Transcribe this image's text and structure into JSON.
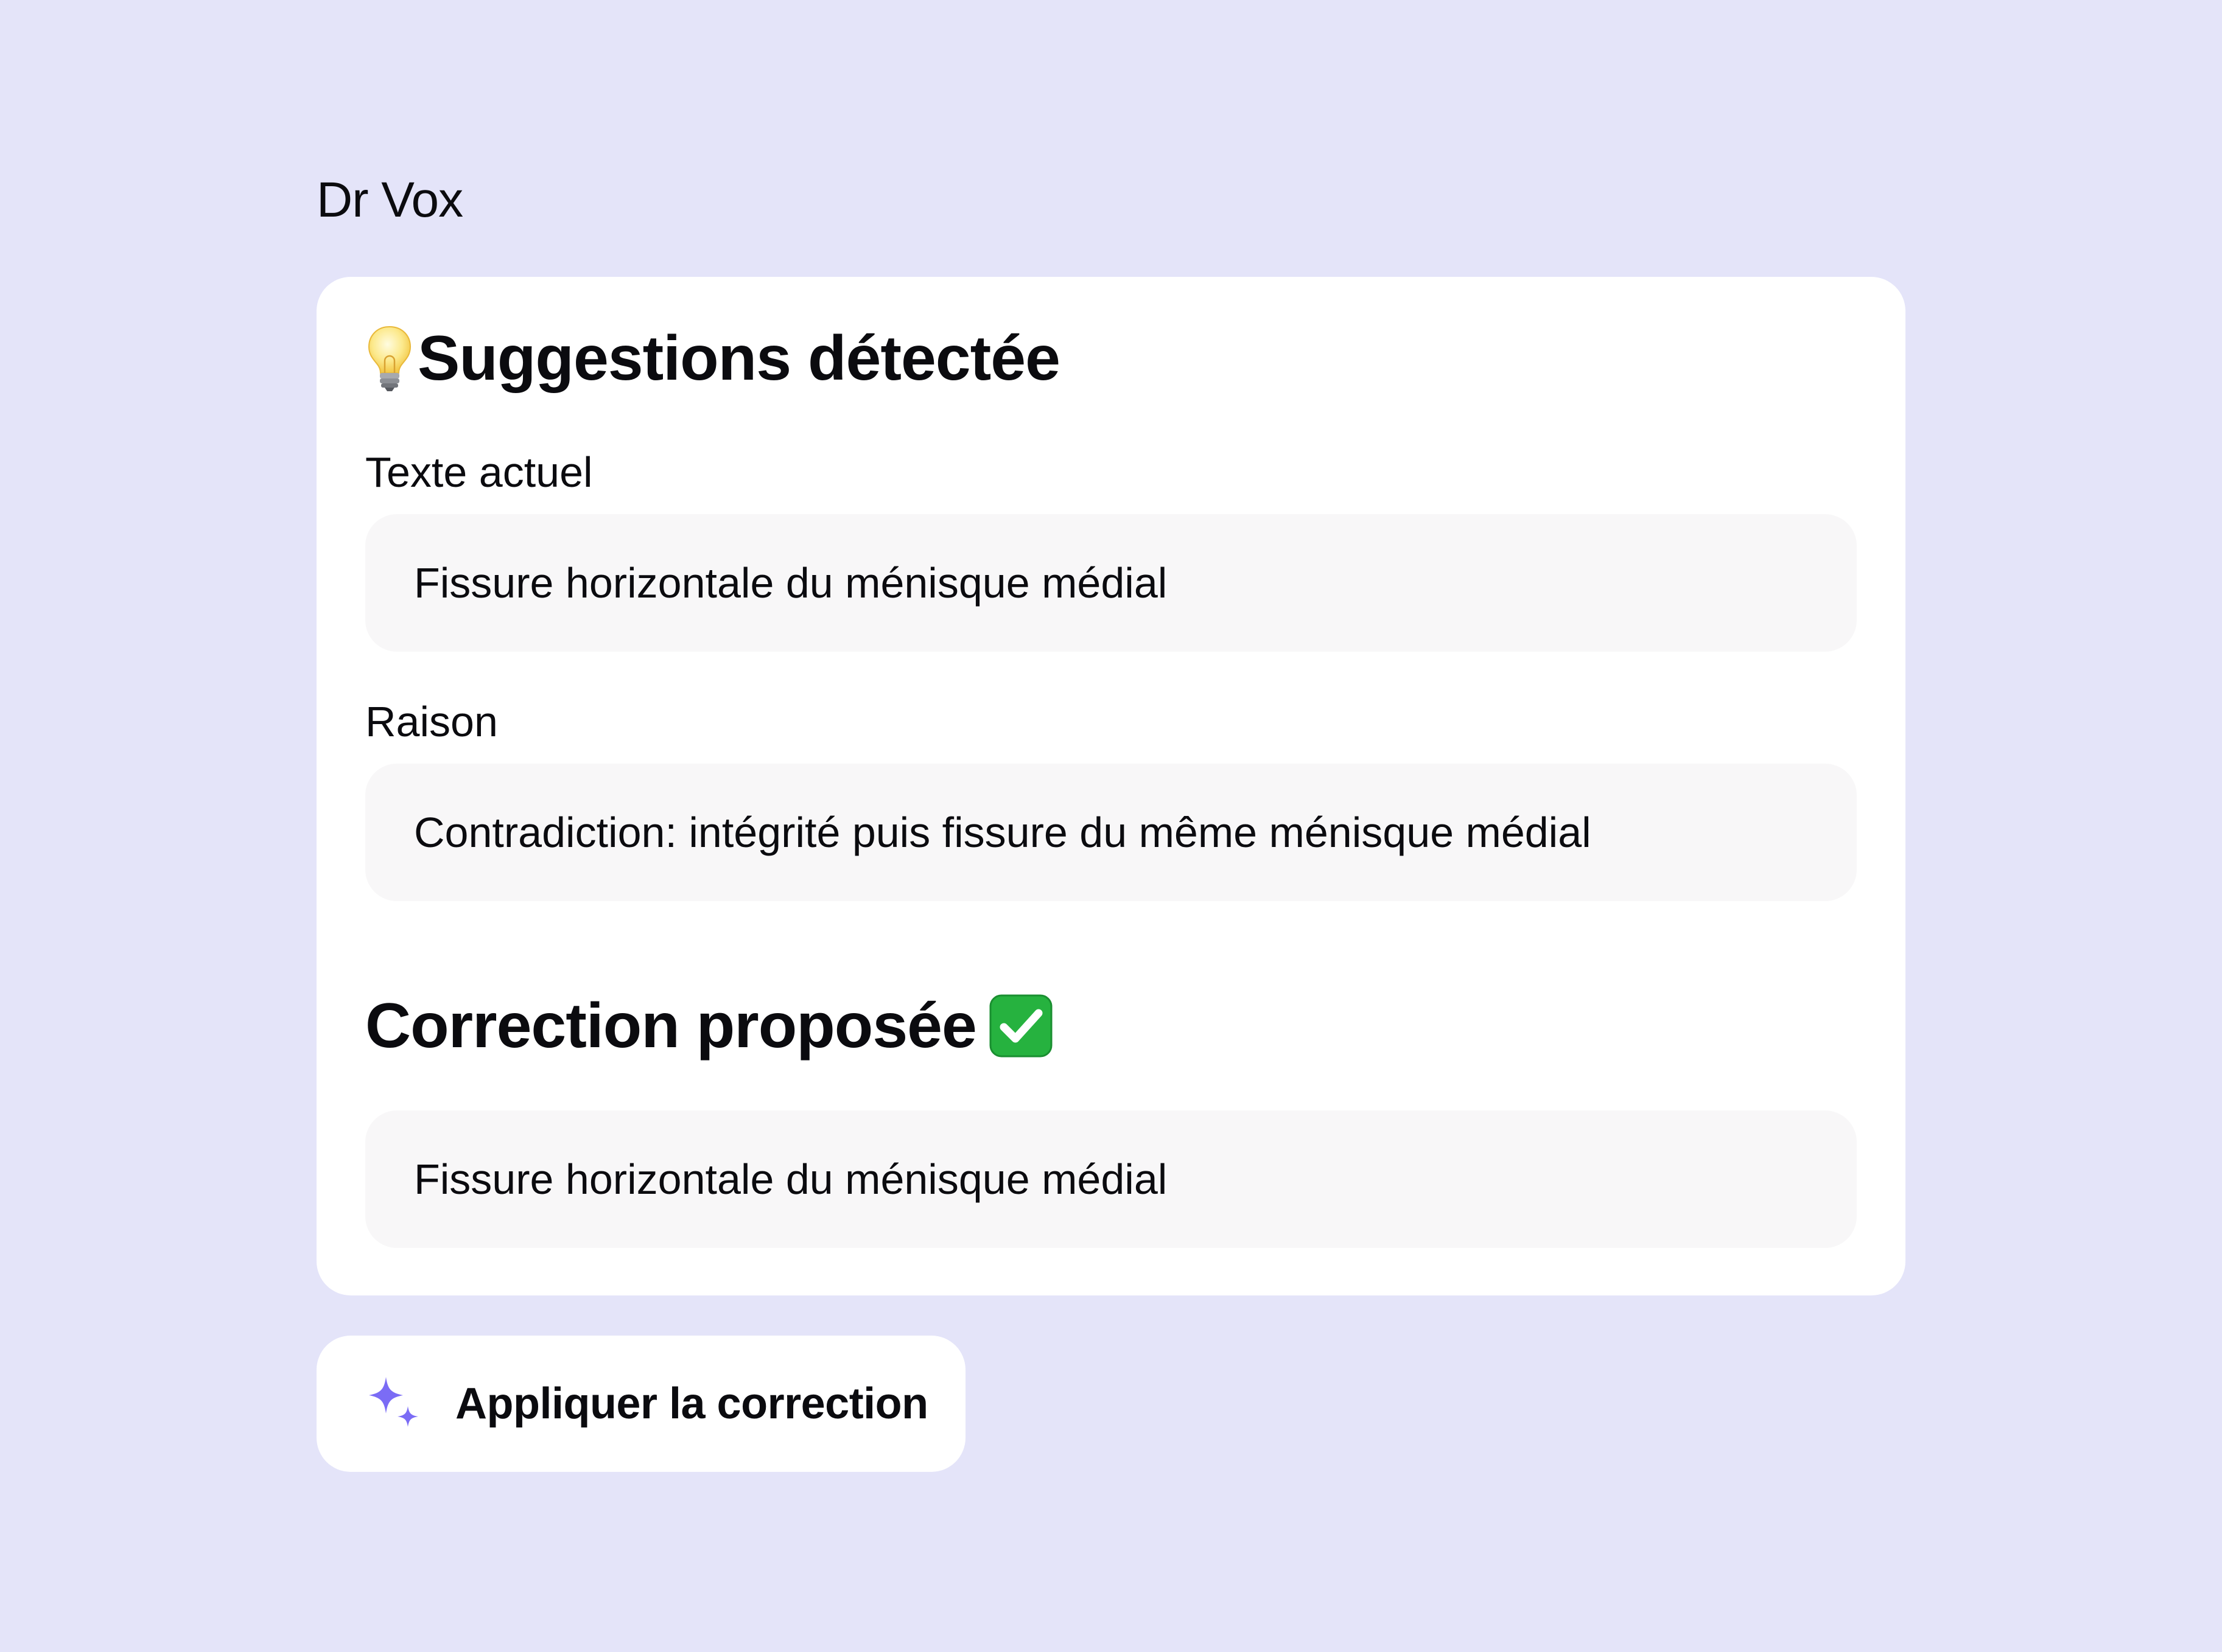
{
  "app": {
    "title": "Dr Vox"
  },
  "suggestion": {
    "title": "Suggestions détectée",
    "title_icon": "lightbulb-icon",
    "current_text_label": "Texte actuel",
    "current_text": "Fissure horizontale du ménisque médial",
    "reason_label": "Raison",
    "reason": "Contradiction: intégrité puis fissure du même ménisque médial"
  },
  "correction": {
    "title": "Correction proposée",
    "title_icon": "check-mark-icon",
    "proposed_text": "Fissure horizontale du ménisque médial"
  },
  "actions": {
    "apply_label": "Appliquer la correction",
    "apply_icon": "sparkles-icon"
  },
  "colors": {
    "background": "#E4E4F9",
    "card": "#FFFFFF",
    "field": "#F8F7F8",
    "accent": "#7B6CF5",
    "check_green": "#26B23F"
  }
}
